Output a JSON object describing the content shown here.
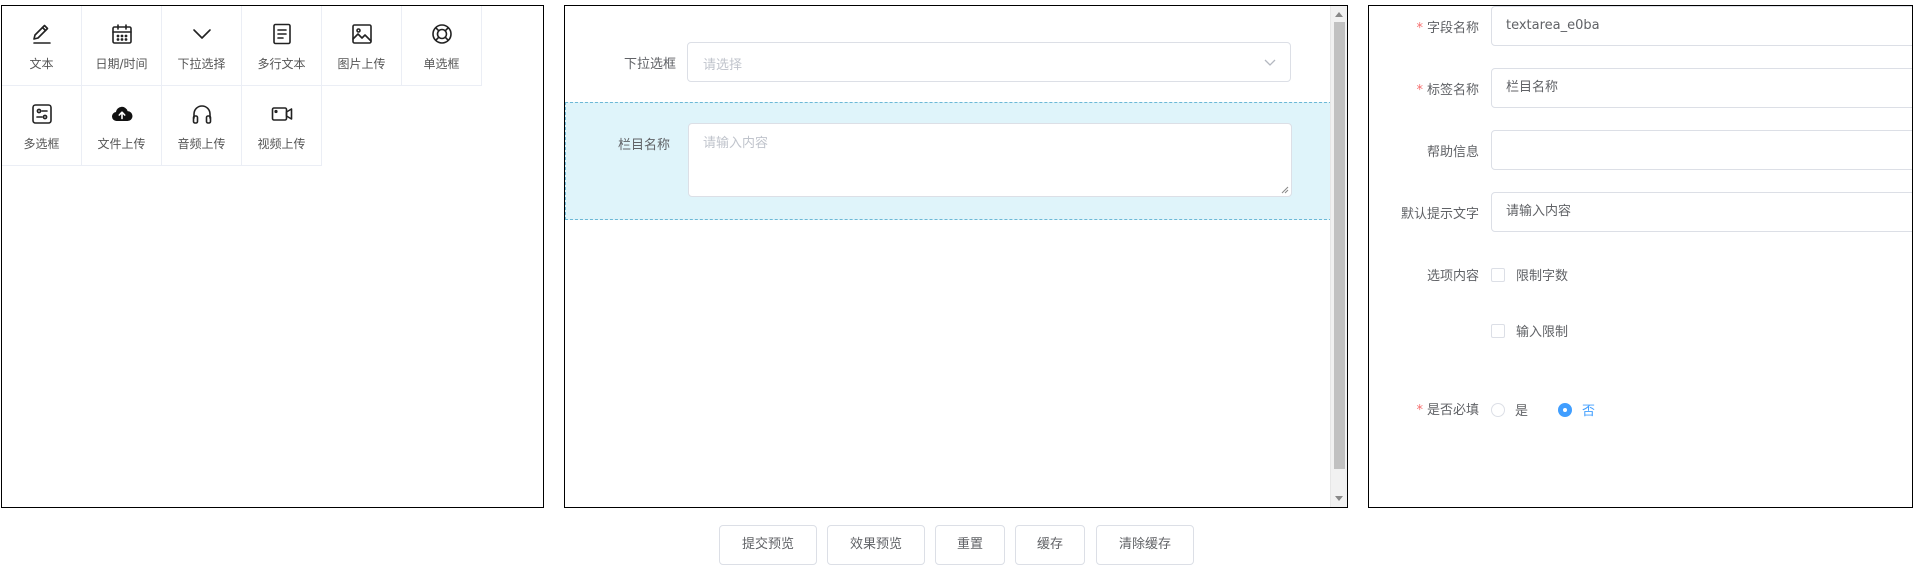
{
  "palette": {
    "items": [
      {
        "label": "文本",
        "icon": "pencil-icon"
      },
      {
        "label": "日期/时间",
        "icon": "calendar-icon"
      },
      {
        "label": "下拉选择",
        "icon": "chevron-down-icon"
      },
      {
        "label": "多行文本",
        "icon": "document-icon"
      },
      {
        "label": "图片上传",
        "icon": "image-icon"
      },
      {
        "label": "单选框",
        "icon": "radio-ring-icon"
      },
      {
        "label": "多选框",
        "icon": "multi-select-icon"
      },
      {
        "label": "文件上传",
        "icon": "cloud-upload-icon"
      },
      {
        "label": "音频上传",
        "icon": "headphones-icon"
      },
      {
        "label": "视频上传",
        "icon": "video-camera-icon"
      }
    ]
  },
  "canvas": {
    "select_field": {
      "label": "下拉选框",
      "placeholder": "请选择"
    },
    "textarea_field": {
      "label": "栏目名称",
      "placeholder": "请输入内容"
    }
  },
  "props": {
    "field_name": {
      "label": "字段名称",
      "value": "textarea_e0ba",
      "required": true
    },
    "tag_name": {
      "label": "标签名称",
      "value": "栏目名称",
      "required": true
    },
    "help_info": {
      "label": "帮助信息",
      "value": ""
    },
    "default_hint": {
      "label": "默认提示文字",
      "value": "请输入内容"
    },
    "options": {
      "label": "选项内容",
      "limit_chars": "限制字数",
      "input_limit": "输入限制"
    },
    "required_field": {
      "label": "是否必填",
      "yes": "是",
      "no": "否",
      "selected": "no"
    },
    "required_mark": "*"
  },
  "buttons": {
    "submit_preview": "提交预览",
    "effect_preview": "效果预览",
    "reset": "重置",
    "cache": "缓存",
    "clear_cache": "清除缓存"
  },
  "colors": {
    "accent": "#409eff",
    "required": "#f56c6c",
    "active_row": "#dff4fa"
  }
}
